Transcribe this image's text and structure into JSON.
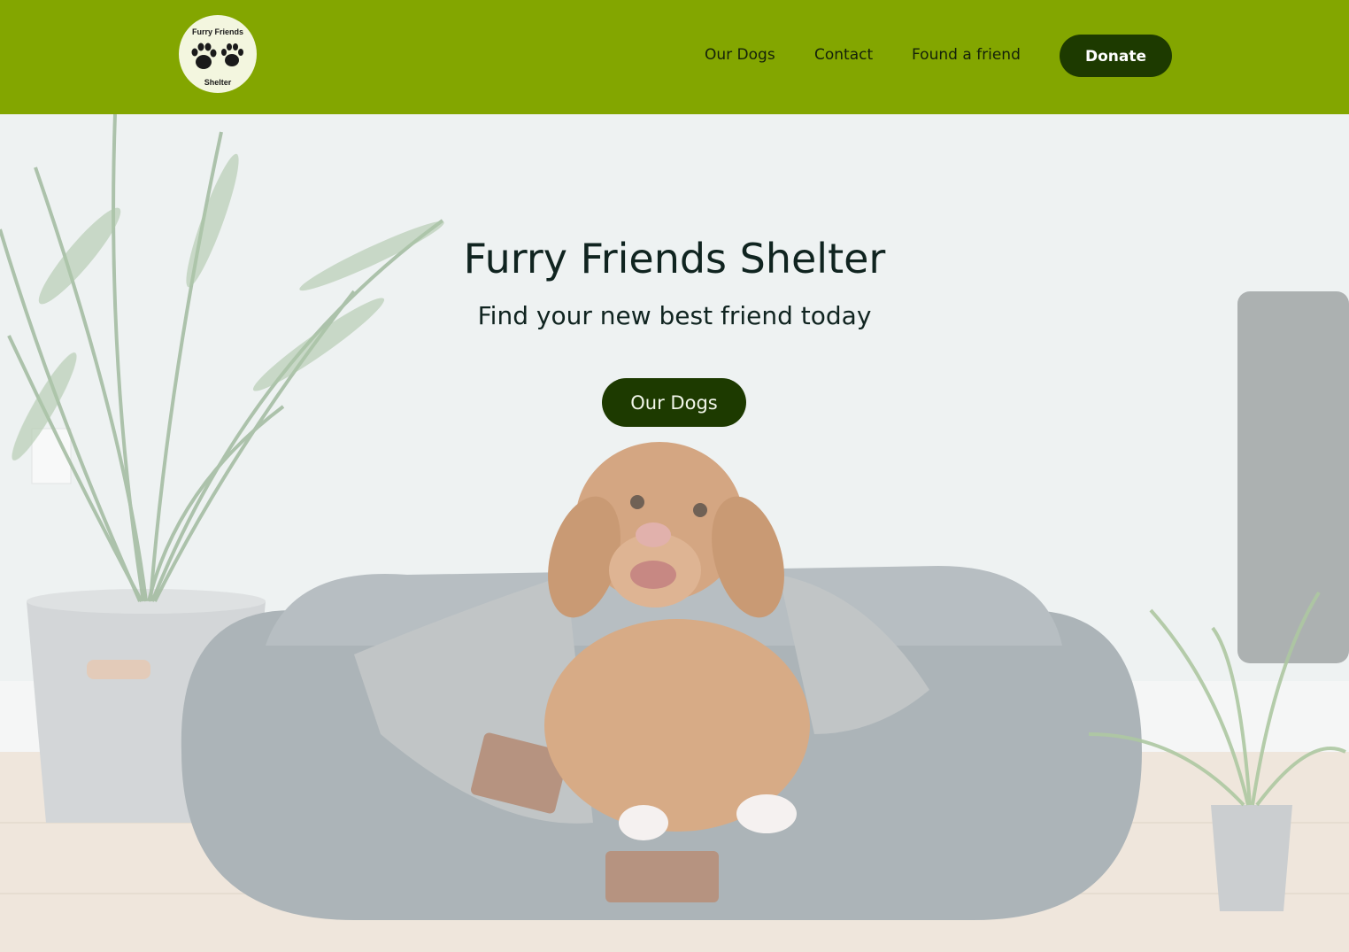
{
  "brand": {
    "logo_line1": "Furry Friends",
    "logo_line2": "Shelter",
    "logo_icon": "paw-prints-icon"
  },
  "nav": {
    "items": [
      {
        "label": "Our Dogs"
      },
      {
        "label": "Contact"
      },
      {
        "label": "Found a friend"
      }
    ],
    "donate_label": "Donate"
  },
  "hero": {
    "title": "Furry Friends Shelter",
    "subtitle": "Find your new best friend today",
    "cta_label": "Our Dogs",
    "background_image": "dog-on-bed-photo"
  },
  "colors": {
    "nav_background": "#83a600",
    "button_background": "#1d3a00",
    "button_text": "#ffffff",
    "logo_background": "#f3f6df"
  }
}
